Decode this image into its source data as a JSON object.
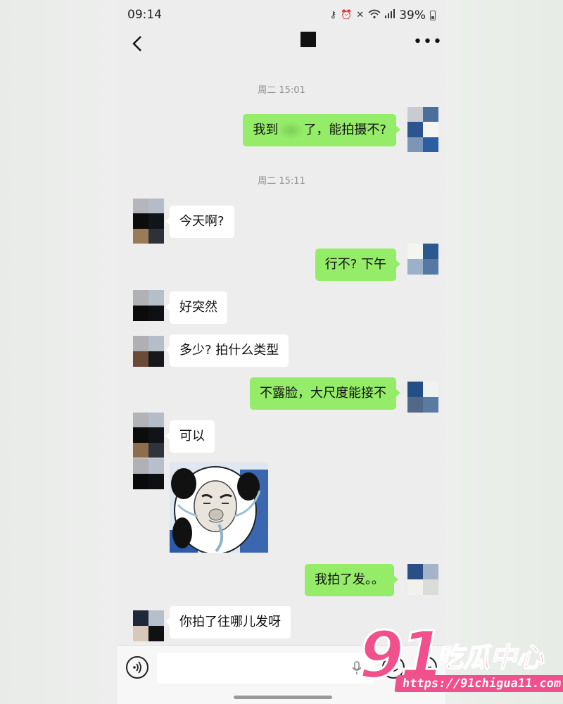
{
  "status_bar": {
    "time": "09:14",
    "battery": "39%"
  },
  "nav": {
    "title": ""
  },
  "messages": {
    "ts1": "周二 15:01",
    "m1_before": "我到",
    "m1_after": "了，能拍摄不?",
    "ts2": "周二 15:11",
    "m2": "今天啊?",
    "m3": "行不? 下午",
    "m4": "好突然",
    "m5": "多少? 拍什么类型",
    "m6": "不露脸，大尺度能接不",
    "m7": "可以",
    "m9": "我拍了发。。",
    "m10": "你拍了往哪儿发呀"
  },
  "input": {
    "placeholder": ""
  },
  "watermark": {
    "num": "91",
    "cn": "吃瓜中心",
    "url": "https://91chigua11.com"
  }
}
